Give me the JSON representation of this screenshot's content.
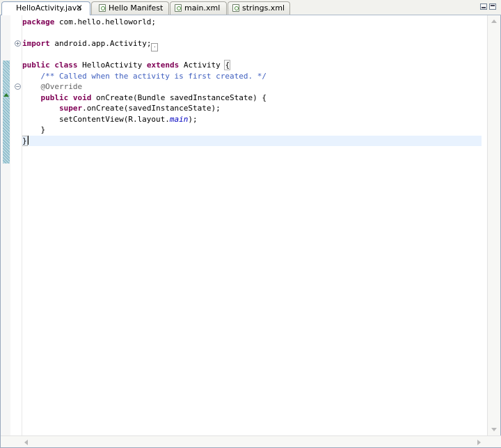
{
  "tabs": [
    {
      "label": "HelloActivity.java",
      "active": true,
      "icon": "java-file-icon"
    },
    {
      "label": "Hello Manifest",
      "active": false,
      "icon": "android-file-icon"
    },
    {
      "label": "main.xml",
      "active": false,
      "icon": "android-file-icon"
    },
    {
      "label": "strings.xml",
      "active": false,
      "icon": "android-file-icon"
    }
  ],
  "tab_close_glyph": "✕",
  "code": {
    "package_kw": "package",
    "package_name": " com.hello.helloworld;",
    "import_kw": "import",
    "import_name": " android.app.Activity;",
    "class_public": "public",
    "class_kw": "class",
    "class_name": " HelloActivity ",
    "extends_kw": "extends",
    "extends_rest": " Activity ",
    "open_brace": "{",
    "comment": "    /** Called when the activity is first created. */",
    "annotation": "    @Override",
    "method_public": "public",
    "method_void": "void",
    "method_sig": " onCreate(Bundle savedInstanceState) {",
    "super_kw": "super",
    "super_call": ".onCreate(savedInstanceState);",
    "set_content_pre": "        setContentView(R.layout.",
    "set_content_field": "main",
    "set_content_post": ");",
    "inner_close": "    }",
    "outer_close": "}"
  },
  "colors": {
    "keyword": "#7f0055",
    "comment": "#3f5fbf",
    "annotation": "#646464",
    "field": "#0000c0",
    "current_line": "#e8f2fe"
  }
}
